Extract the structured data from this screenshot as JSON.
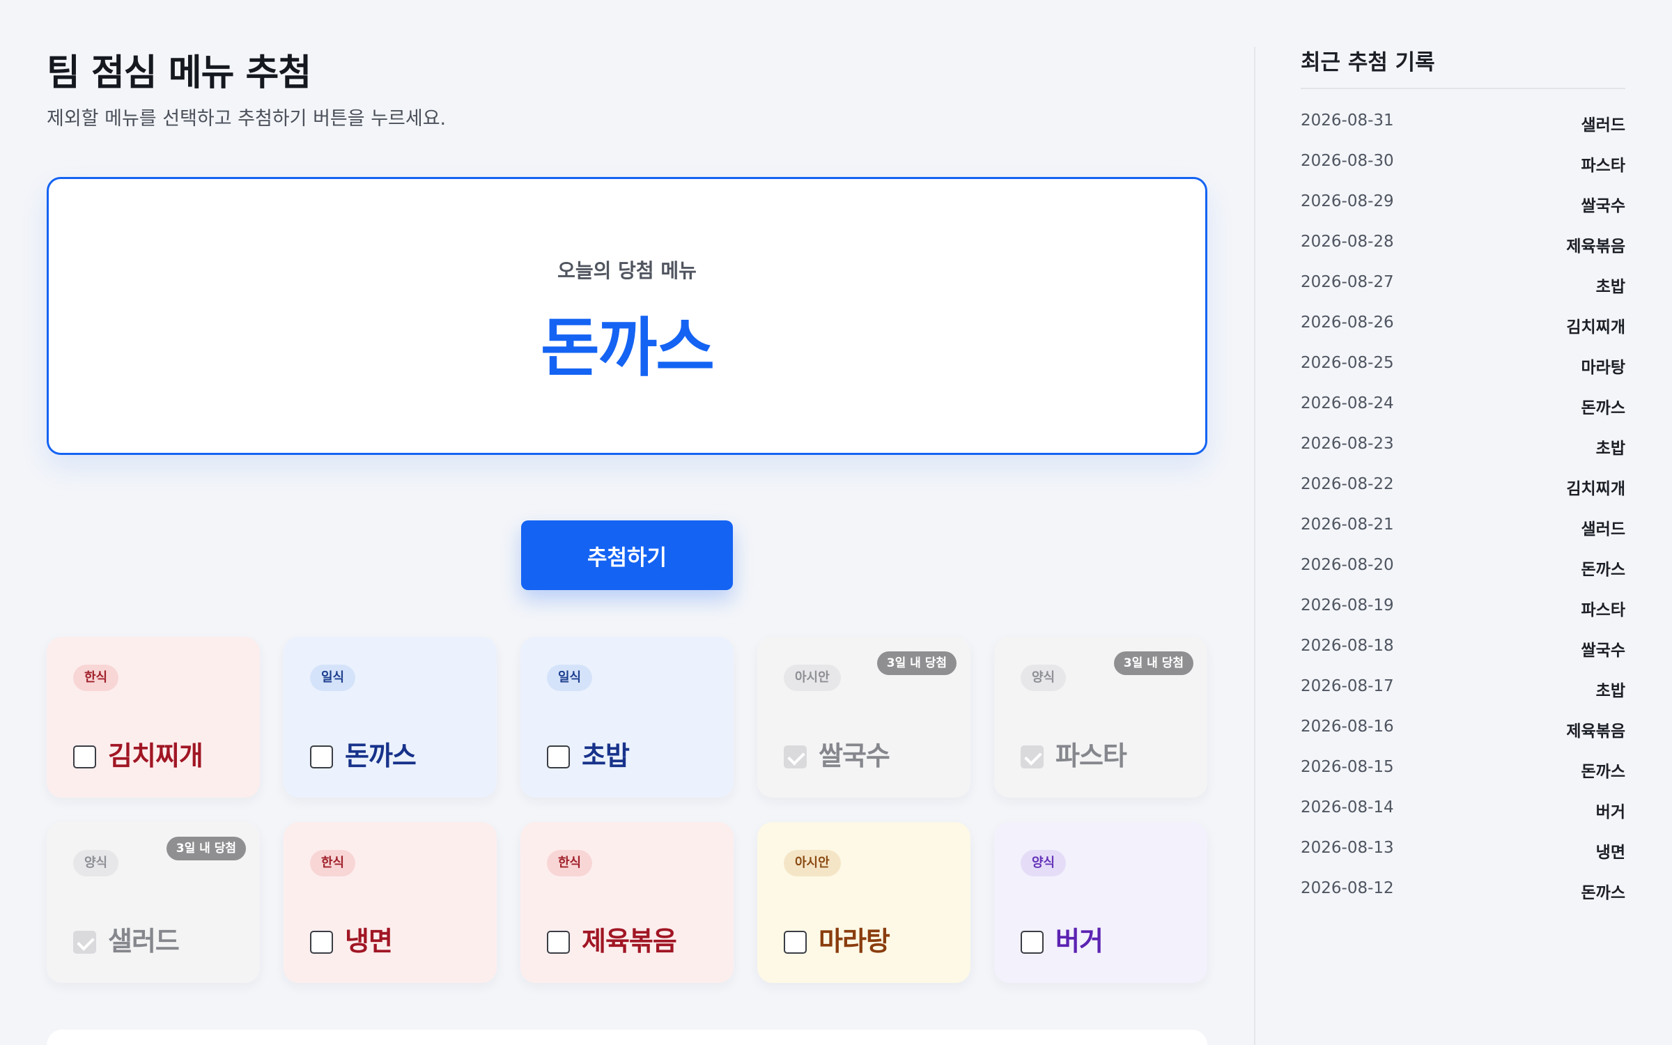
{
  "header": {
    "title": "팀 점심 메뉴 추첨",
    "subtitle": "제외할 메뉴를 선택하고 추첨하기 버튼을 누르세요."
  },
  "result": {
    "label": "오늘의 당첨 메뉴",
    "menu": "돈까스",
    "accent_color": "#1463f3"
  },
  "draw_button": {
    "label": "추첨하기"
  },
  "recent_badge_label": "3일 내 당첨",
  "menus": [
    {
      "category": "한식",
      "name": "김치찌개",
      "checked": false,
      "disabled": false,
      "recent": false
    },
    {
      "category": "일식",
      "name": "돈까스",
      "checked": false,
      "disabled": false,
      "recent": false
    },
    {
      "category": "일식",
      "name": "초밥",
      "checked": false,
      "disabled": false,
      "recent": false
    },
    {
      "category": "아시안",
      "name": "쌀국수",
      "checked": true,
      "disabled": true,
      "recent": true
    },
    {
      "category": "양식",
      "name": "파스타",
      "checked": true,
      "disabled": true,
      "recent": true
    },
    {
      "category": "양식",
      "name": "샐러드",
      "checked": true,
      "disabled": true,
      "recent": true
    },
    {
      "category": "한식",
      "name": "냉면",
      "checked": false,
      "disabled": false,
      "recent": false
    },
    {
      "category": "한식",
      "name": "제육볶음",
      "checked": false,
      "disabled": false,
      "recent": false
    },
    {
      "category": "아시안",
      "name": "마라탕",
      "checked": false,
      "disabled": false,
      "recent": false
    },
    {
      "category": "양식",
      "name": "버거",
      "checked": false,
      "disabled": false,
      "recent": false
    }
  ],
  "category_colors": {
    "한식": "#a01624",
    "일식": "#17328a",
    "아시안": "#8a3d0e",
    "양식": "#5b22b2"
  },
  "sidebar": {
    "title": "최근 추첨 기록",
    "history": [
      {
        "date": "2026-08-31",
        "menu": "샐러드"
      },
      {
        "date": "2026-08-30",
        "menu": "파스타"
      },
      {
        "date": "2026-08-29",
        "menu": "쌀국수"
      },
      {
        "date": "2026-08-28",
        "menu": "제육볶음"
      },
      {
        "date": "2026-08-27",
        "menu": "초밥"
      },
      {
        "date": "2026-08-26",
        "menu": "김치찌개"
      },
      {
        "date": "2026-08-25",
        "menu": "마라탕"
      },
      {
        "date": "2026-08-24",
        "menu": "돈까스"
      },
      {
        "date": "2026-08-23",
        "menu": "초밥"
      },
      {
        "date": "2026-08-22",
        "menu": "김치찌개"
      },
      {
        "date": "2026-08-21",
        "menu": "샐러드"
      },
      {
        "date": "2026-08-20",
        "menu": "돈까스"
      },
      {
        "date": "2026-08-19",
        "menu": "파스타"
      },
      {
        "date": "2026-08-18",
        "menu": "쌀국수"
      },
      {
        "date": "2026-08-17",
        "menu": "초밥"
      },
      {
        "date": "2026-08-16",
        "menu": "제육볶음"
      },
      {
        "date": "2026-08-15",
        "menu": "돈까스"
      },
      {
        "date": "2026-08-14",
        "menu": "버거"
      },
      {
        "date": "2026-08-13",
        "menu": "냉면"
      },
      {
        "date": "2026-08-12",
        "menu": "돈까스"
      }
    ]
  }
}
